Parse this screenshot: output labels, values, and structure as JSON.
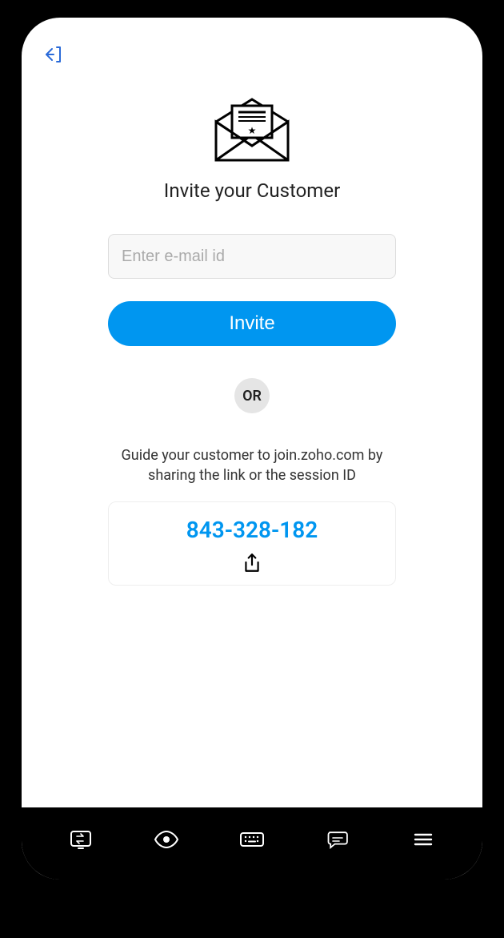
{
  "header": {
    "back": "back"
  },
  "main": {
    "title": "Invite your Customer",
    "email_placeholder": "Enter e-mail id",
    "invite_label": "Invite",
    "or_label": "OR",
    "guide_text": "Guide your customer to join.zoho.com by sharing the link or the session ID",
    "session_id": "843-328-182"
  },
  "nav": {
    "item1": "swap",
    "item2": "view",
    "item3": "keyboard",
    "item4": "chat",
    "item5": "menu"
  },
  "colors": {
    "accent": "#0096F0"
  }
}
